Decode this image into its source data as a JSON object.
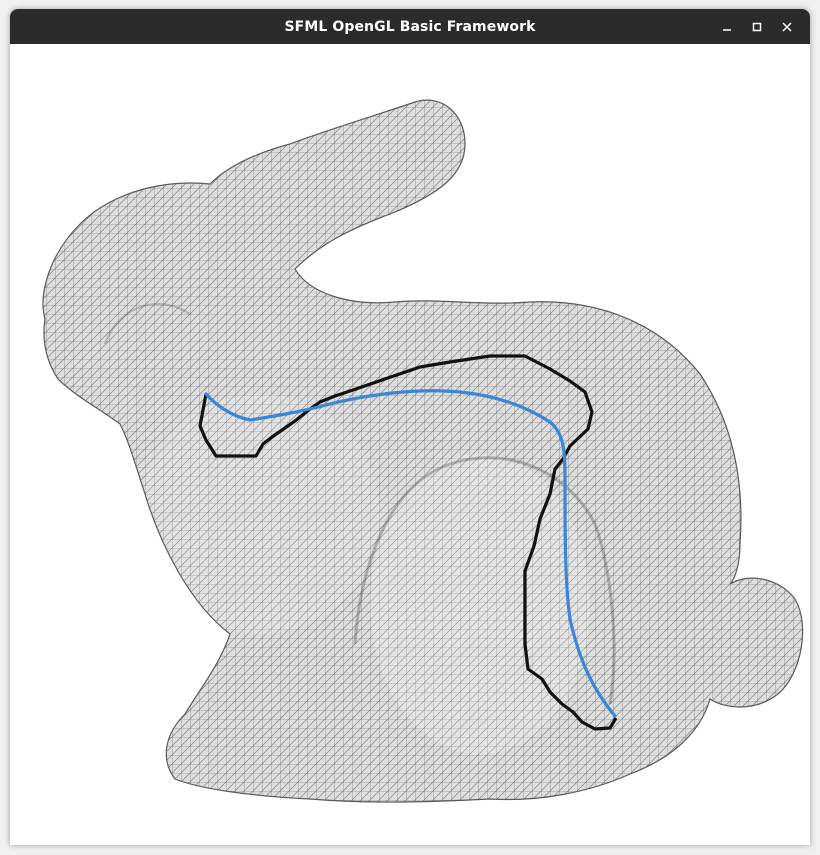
{
  "window": {
    "title": "SFML OpenGL Basic Framework",
    "controls": [
      {
        "name": "minimize-icon",
        "label": "minimize"
      },
      {
        "name": "maximize-icon",
        "label": "maximize"
      },
      {
        "name": "close-icon",
        "label": "close"
      }
    ]
  },
  "scene": {
    "model": "bunny-wireframe-mesh",
    "colors": {
      "background": "#ffffff",
      "mesh_fill": "#dcdcdc",
      "mesh_lines": "#6e6e6e",
      "geodesic_path": "#3a86d8",
      "edge_path": "#111111"
    }
  }
}
